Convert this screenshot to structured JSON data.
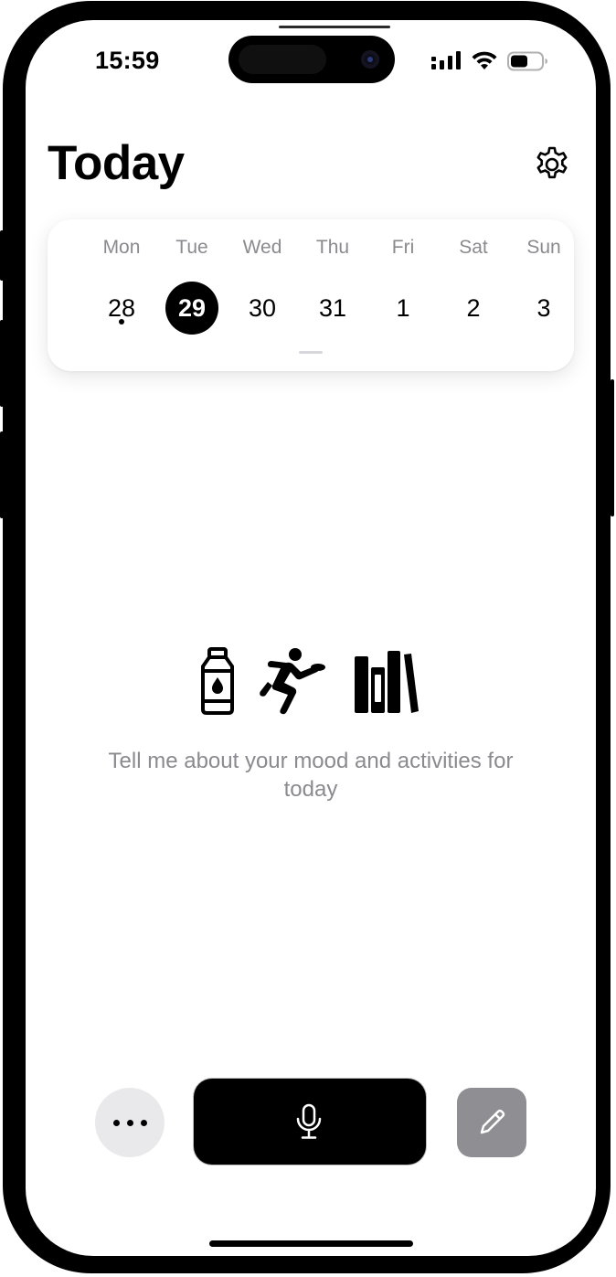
{
  "status_bar": {
    "time": "15:59",
    "icons": [
      "cellular-signal-icon",
      "wifi-icon",
      "battery-icon"
    ]
  },
  "header": {
    "title": "Today",
    "settings_icon": "gear-icon"
  },
  "week": {
    "days": [
      {
        "name": "Mon",
        "date": "28",
        "selected": false,
        "has_entry": true
      },
      {
        "name": "Tue",
        "date": "29",
        "selected": true,
        "has_entry": false
      },
      {
        "name": "Wed",
        "date": "30",
        "selected": false,
        "has_entry": false
      },
      {
        "name": "Thu",
        "date": "31",
        "selected": false,
        "has_entry": false
      },
      {
        "name": "Fri",
        "date": "1",
        "selected": false,
        "has_entry": false
      },
      {
        "name": "Sat",
        "date": "2",
        "selected": false,
        "has_entry": false
      },
      {
        "name": "Sun",
        "date": "3",
        "selected": false,
        "has_entry": false
      }
    ]
  },
  "empty_state": {
    "icons": [
      "water-bottle-icon",
      "runner-icon",
      "books-icon"
    ],
    "prompt": "Tell me about your mood and activities for today"
  },
  "bottom_bar": {
    "more_icon": "ellipsis-icon",
    "mic_icon": "microphone-icon",
    "edit_icon": "pencil-icon"
  },
  "colors": {
    "accent": "#000000",
    "secondary_text": "#8a8a8f",
    "more_button_bg": "#e9e9eb",
    "edit_button_bg": "#8e8e93"
  }
}
